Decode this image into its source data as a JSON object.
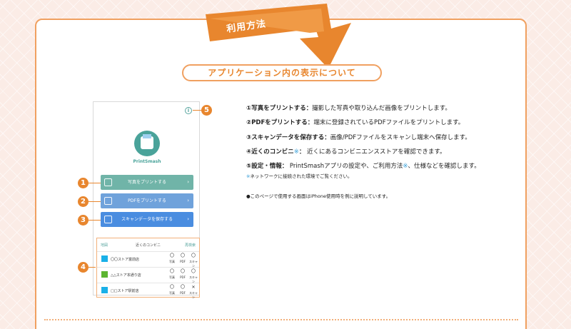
{
  "header": {
    "banner_label": "利用方法",
    "section_title": "アプリケーション内の表示について"
  },
  "phone": {
    "app_name": "PrintSmash",
    "info_icon": "i",
    "buttons": [
      {
        "label": "写真をプリントする",
        "icon": "photo-icon",
        "color": "#70b4a8"
      },
      {
        "label": "PDFをプリントする",
        "icon": "document-icon",
        "color": "#6fa2db"
      },
      {
        "label": "スキャンデータを保存する",
        "icon": "scan-icon",
        "color": "#4a8de0"
      }
    ],
    "chevron": "›",
    "stores": {
      "map_label": "地図",
      "title": "近くのコンビニ",
      "reload_label": "再検索",
      "col_labels": [
        "写真",
        "PDF",
        "スキャン"
      ],
      "rows": [
        {
          "name": "〇〇ストア富前店",
          "color": "#1ab0e8",
          "marks": [
            "〇",
            "〇",
            "〇"
          ]
        },
        {
          "name": "△△ストア本通り店",
          "color": "#5cb531",
          "marks": [
            "〇",
            "〇",
            "〇"
          ]
        },
        {
          "name": "□□ストア駅前店",
          "color": "#1ab0e8",
          "marks": [
            "〇",
            "〇",
            "✕"
          ]
        }
      ]
    }
  },
  "callouts": [
    "1",
    "2",
    "3",
    "4",
    "5"
  ],
  "descriptions": [
    {
      "head": "①写真をプリントする",
      "sep": "：",
      "body": "撮影した写真や取り込んだ画像をプリントします。"
    },
    {
      "head": "②PDFをプリントする",
      "sep": "：",
      "body": "端末に登録されているPDFファイルをプリントします。"
    },
    {
      "head": "③スキャンデータを保存する",
      "sep": "：",
      "body": "画像/PDFファイルをスキャンし端末へ保存します。"
    },
    {
      "head": "④近くのコンビニ",
      "mark": "※",
      "sep": "：",
      "body": "近くにあるコンビニエンスストアを確認できます。"
    },
    {
      "head": "⑤設定・情報",
      "sep": "：",
      "body_a": "PrintSmashアプリの設定や、ご利用方法",
      "mark": "※",
      "body_b": "、仕様などを確認します。"
    }
  ],
  "notes": {
    "network_mark": "※",
    "network": "ネットワークに接続された環境でご覧ください。",
    "iphone": "●このページで使用する画面はiPhone使用時を例に説明しています。"
  },
  "colors": {
    "accent_orange": "#e8862e",
    "border_orange": "#f0a060",
    "teal": "#4aa39a",
    "link_blue": "#3aa0d8"
  }
}
